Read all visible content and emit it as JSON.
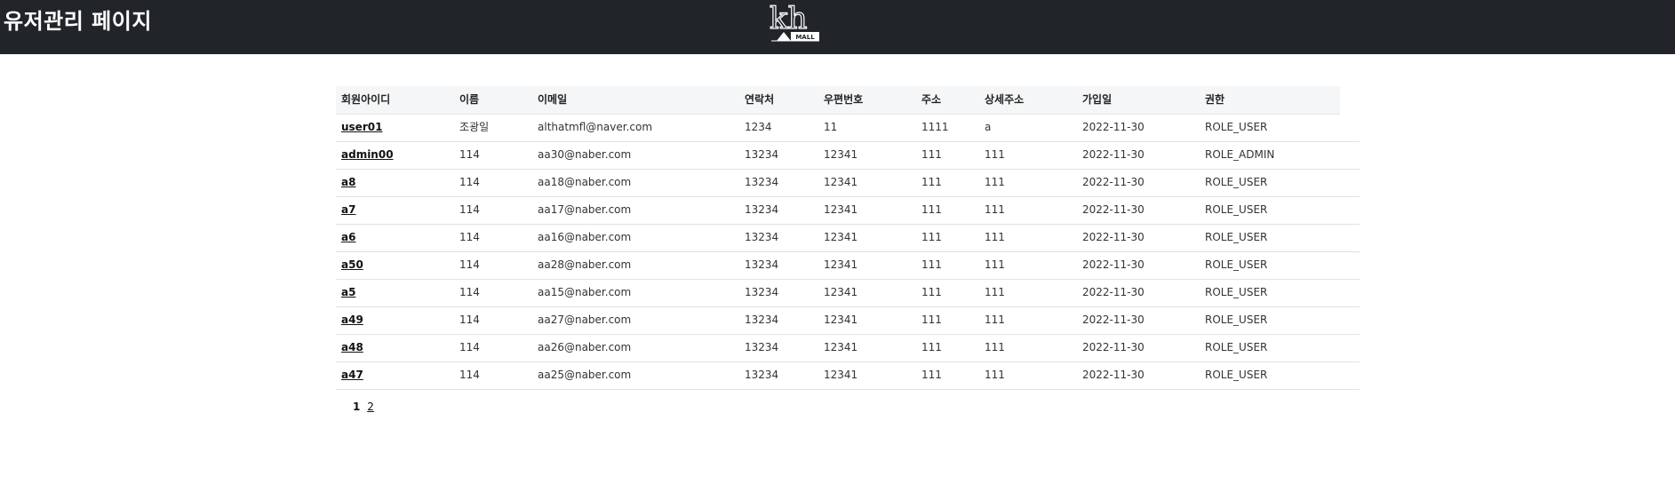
{
  "header": {
    "title": "유저관리 페이지",
    "logo": {
      "icon": "kh-mall-logo-icon",
      "text_main": "kh",
      "text_sub": "MALL"
    }
  },
  "table": {
    "columns": [
      "회원아이디",
      "이름",
      "이메일",
      "연락처",
      "우편번호",
      "주소",
      "상세주소",
      "가입일",
      "권한"
    ],
    "rows": [
      [
        "user01",
        "조광일",
        "althatmfl@naver.com",
        "1234",
        "11",
        "1111",
        "a",
        "2022-11-30",
        "ROLE_USER"
      ],
      [
        "admin00",
        "114",
        "aa30@naber.com",
        "13234",
        "12341",
        "111",
        "111",
        "2022-11-30",
        "ROLE_ADMIN"
      ],
      [
        "a8",
        "114",
        "aa18@naber.com",
        "13234",
        "12341",
        "111",
        "111",
        "2022-11-30",
        "ROLE_USER"
      ],
      [
        "a7",
        "114",
        "aa17@naber.com",
        "13234",
        "12341",
        "111",
        "111",
        "2022-11-30",
        "ROLE_USER"
      ],
      [
        "a6",
        "114",
        "aa16@naber.com",
        "13234",
        "12341",
        "111",
        "111",
        "2022-11-30",
        "ROLE_USER"
      ],
      [
        "a50",
        "114",
        "aa28@naber.com",
        "13234",
        "12341",
        "111",
        "111",
        "2022-11-30",
        "ROLE_USER"
      ],
      [
        "a5",
        "114",
        "aa15@naber.com",
        "13234",
        "12341",
        "111",
        "111",
        "2022-11-30",
        "ROLE_USER"
      ],
      [
        "a49",
        "114",
        "aa27@naber.com",
        "13234",
        "12341",
        "111",
        "111",
        "2022-11-30",
        "ROLE_USER"
      ],
      [
        "a48",
        "114",
        "aa26@naber.com",
        "13234",
        "12341",
        "111",
        "111",
        "2022-11-30",
        "ROLE_USER"
      ],
      [
        "a47",
        "114",
        "aa25@naber.com",
        "13234",
        "12341",
        "111",
        "111",
        "2022-11-30",
        "ROLE_USER"
      ]
    ]
  },
  "pagination": {
    "current": "1",
    "pages": [
      "2"
    ]
  }
}
